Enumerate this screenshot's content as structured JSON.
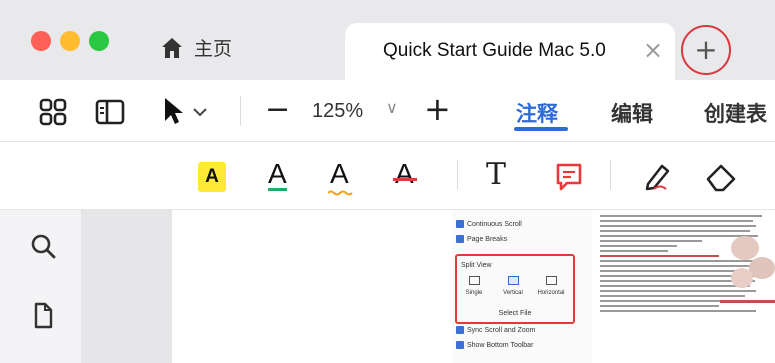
{
  "tabbar": {
    "home_tab_label": "主页",
    "doc_tab_label": "Quick Start Guide Mac 5.0",
    "close_glyph": "×",
    "add_glyph": "+"
  },
  "toolbar": {
    "zoom_minus": "−",
    "zoom_value": "125%",
    "zoom_chevron": "∨",
    "zoom_plus": "+",
    "mode_tabs": [
      {
        "label": "注释",
        "active": true
      },
      {
        "label": "编辑",
        "active": false
      },
      {
        "label": "创建表",
        "active": false
      }
    ]
  },
  "annotation_tools": {
    "highlight_letter": "A",
    "underline_letter": "A",
    "squiggly_letter": "A",
    "strike_letter": "A",
    "text_tool": "T"
  },
  "colors": {
    "accent": "#2c6bd9",
    "highlight": "#fde936",
    "underline": "#1ab06b",
    "squiggly": "#f0a020",
    "strike": "#e03a3a",
    "comment": "#e8393a",
    "circle": "#d9383f"
  },
  "pdf_settings_panel": {
    "items_top": [
      "Continuous Scroll",
      "Page Breaks"
    ],
    "split_view_heading": "Split View",
    "split_options": [
      {
        "label": "Single",
        "selected": false
      },
      {
        "label": "Vertical",
        "selected": true
      },
      {
        "label": "Horizontal",
        "selected": false
      }
    ],
    "select_file": "Select File",
    "items_bottom": [
      "Sync Scroll and Zoom",
      "Show Bottom Toolbar"
    ]
  },
  "icons": [
    "grid-view-icon",
    "sidebar-panel-icon",
    "pointer-icon",
    "chevron-down-icon",
    "search-icon",
    "page-icon",
    "pen-icon",
    "eraser-icon",
    "comment-icon",
    "home-icon"
  ]
}
